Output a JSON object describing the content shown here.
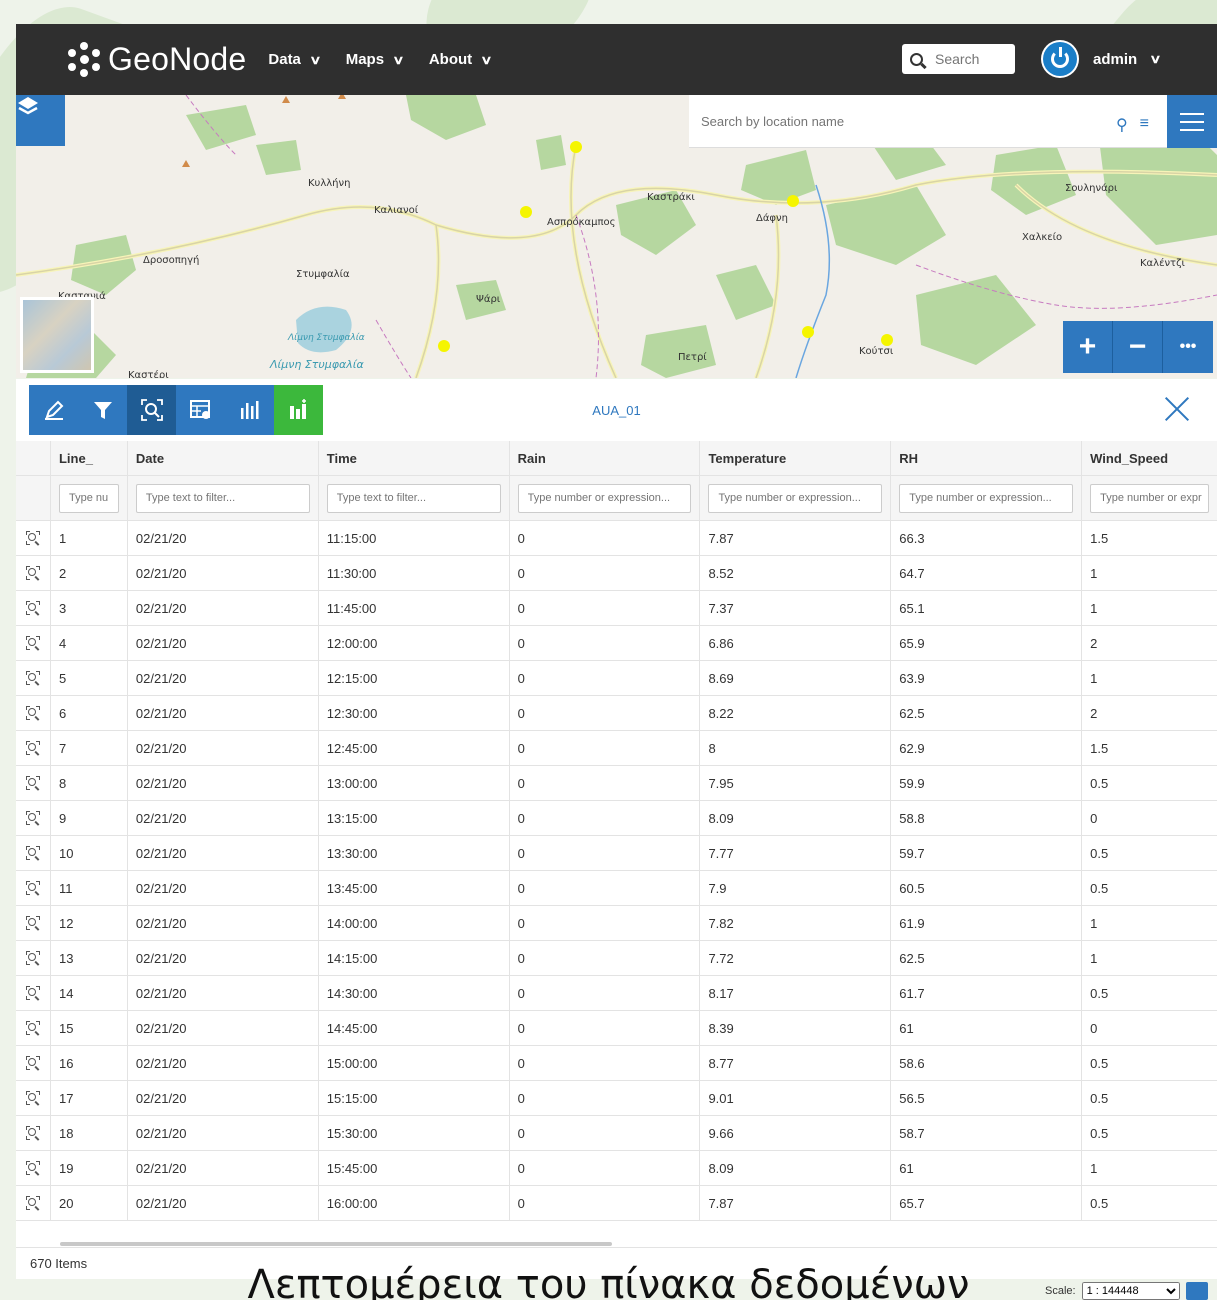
{
  "navbar": {
    "logo_text": "GeoNode",
    "menu": [
      {
        "label": "Data"
      },
      {
        "label": "Maps"
      },
      {
        "label": "About"
      }
    ],
    "search_placeholder": "Search",
    "user": "admin"
  },
  "map": {
    "search_placeholder": "Search by location name",
    "labels": [
      "Κυλλήνη",
      "Καλιανοί",
      "Δροσοπηγή",
      "Στυμφαλία",
      "Ασπρόκαμπος",
      "Καστράκι",
      "Δάφνη",
      "Σουληνάρι",
      "Χαλκείο",
      "Καλέντζι",
      "Ψάρι",
      "Λίμνη Στυμφαλία",
      "Λίμνη Στυμφαλία",
      "Πετρί",
      "Κούτσι",
      "Καστανιά",
      "Καστέρι"
    ],
    "zoom_in": "+",
    "zoom_out": "−",
    "more": "•••"
  },
  "panel": {
    "layer_title": "AUA_01",
    "columns": [
      "Line_",
      "Date",
      "Time",
      "Rain",
      "Temperature",
      "RH",
      "Wind_Speed"
    ],
    "filter_placeholders": [
      "Type nu",
      "Type text to filter...",
      "Type text to filter...",
      "Type number or expression...",
      "Type number or expression...",
      "Type number or expression...",
      "Type number or expr"
    ],
    "rows": [
      [
        "1",
        "02/21/20",
        "11:15:00",
        "0",
        "7.87",
        "66.3",
        "1.5"
      ],
      [
        "2",
        "02/21/20",
        "11:30:00",
        "0",
        "8.52",
        "64.7",
        "1"
      ],
      [
        "3",
        "02/21/20",
        "11:45:00",
        "0",
        "7.37",
        "65.1",
        "1"
      ],
      [
        "4",
        "02/21/20",
        "12:00:00",
        "0",
        "6.86",
        "65.9",
        "2"
      ],
      [
        "5",
        "02/21/20",
        "12:15:00",
        "0",
        "8.69",
        "63.9",
        "1"
      ],
      [
        "6",
        "02/21/20",
        "12:30:00",
        "0",
        "8.22",
        "62.5",
        "2"
      ],
      [
        "7",
        "02/21/20",
        "12:45:00",
        "0",
        "8",
        "62.9",
        "1.5"
      ],
      [
        "8",
        "02/21/20",
        "13:00:00",
        "0",
        "7.95",
        "59.9",
        "0.5"
      ],
      [
        "9",
        "02/21/20",
        "13:15:00",
        "0",
        "8.09",
        "58.8",
        "0"
      ],
      [
        "10",
        "02/21/20",
        "13:30:00",
        "0",
        "7.77",
        "59.7",
        "0.5"
      ],
      [
        "11",
        "02/21/20",
        "13:45:00",
        "0",
        "7.9",
        "60.5",
        "0.5"
      ],
      [
        "12",
        "02/21/20",
        "14:00:00",
        "0",
        "7.82",
        "61.9",
        "1"
      ],
      [
        "13",
        "02/21/20",
        "14:15:00",
        "0",
        "7.72",
        "62.5",
        "1"
      ],
      [
        "14",
        "02/21/20",
        "14:30:00",
        "0",
        "8.17",
        "61.7",
        "0.5"
      ],
      [
        "15",
        "02/21/20",
        "14:45:00",
        "0",
        "8.39",
        "61",
        "0"
      ],
      [
        "16",
        "02/21/20",
        "15:00:00",
        "0",
        "8.77",
        "58.6",
        "0.5"
      ],
      [
        "17",
        "02/21/20",
        "15:15:00",
        "0",
        "9.01",
        "56.5",
        "0.5"
      ],
      [
        "18",
        "02/21/20",
        "15:30:00",
        "0",
        "9.66",
        "58.7",
        "0.5"
      ],
      [
        "19",
        "02/21/20",
        "15:45:00",
        "0",
        "8.09",
        "61",
        "1"
      ],
      [
        "20",
        "02/21/20",
        "16:00:00",
        "0",
        "7.87",
        "65.7",
        "0.5"
      ]
    ],
    "item_count": "670 Items"
  },
  "caption": "Λεπτομέρεια του πίνακα δεδομένων",
  "scale": {
    "label": "Scale:",
    "value": "1 : 144448"
  },
  "colors": {
    "navbar": "#2f2f2f",
    "accent": "#2f78bf",
    "chart_button": "#3cb83c",
    "marker": "#f5f500"
  }
}
